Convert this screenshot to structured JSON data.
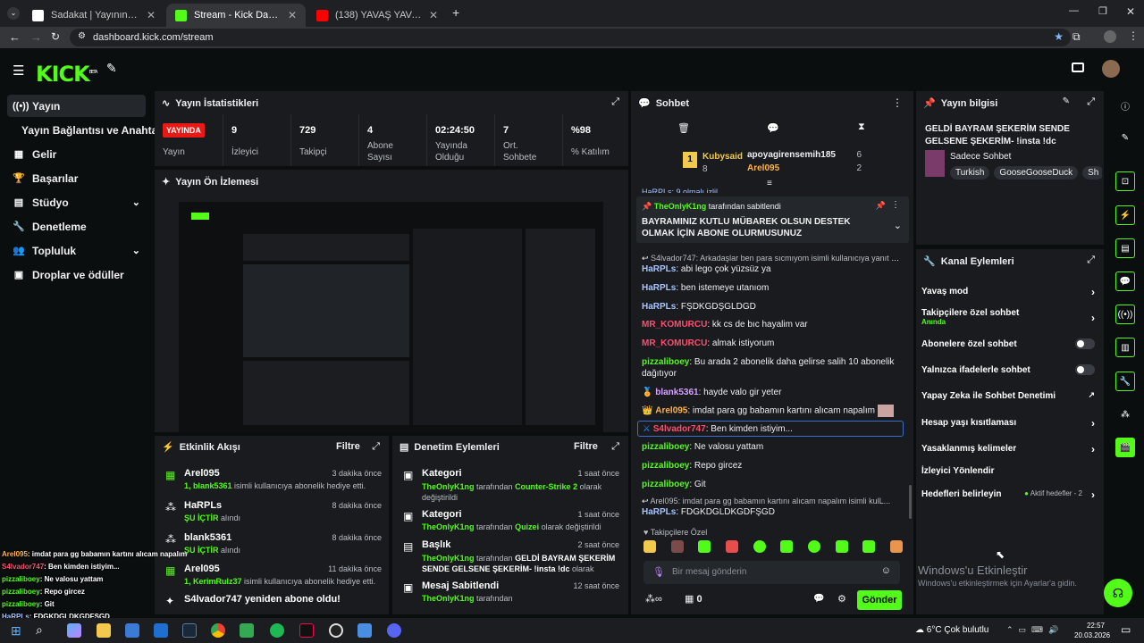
{
  "browser": {
    "tabs": [
      {
        "title": "Sadakat | Yayınını güçlendirmek"
      },
      {
        "title": "Stream - Kick Dashboard"
      },
      {
        "title": "(138) YAVAŞ YAVAŞ GELİŞİYORU"
      }
    ],
    "url": "dashboard.kick.com/stream"
  },
  "brand": {
    "logo": "KICK",
    "beta": "BETA",
    "accent": "#53fc18"
  },
  "sidebar": {
    "items": [
      {
        "label": "Yayın",
        "icon": "broadcast-icon"
      },
      {
        "label": "Yayın Bağlantısı ve Anahtarı"
      },
      {
        "label": "Gelir",
        "icon": "revenue-icon"
      },
      {
        "label": "Başarılar",
        "icon": "trophy-icon"
      },
      {
        "label": "Stüdyo",
        "icon": "studio-icon"
      },
      {
        "label": "Denetleme",
        "icon": "wrench-icon"
      },
      {
        "label": "Topluluk",
        "icon": "community-icon"
      },
      {
        "label": "Droplar ve ödüller",
        "icon": "drops-icon"
      }
    ]
  },
  "stats": {
    "title": "Yayın İstatistikleri",
    "live_badge": "YAYINDA",
    "live_label": "Yayın",
    "items": [
      {
        "value": "9",
        "label": "İzleyici"
      },
      {
        "value": "729",
        "label": "Takipçi"
      },
      {
        "value": "4",
        "label": "Abone Sayısı"
      },
      {
        "value": "02:24:50",
        "label": "Yayında Olduğu"
      },
      {
        "value": "7",
        "label": "Ort. Sohbete"
      },
      {
        "value": "%98",
        "label": "% Katılım"
      }
    ]
  },
  "preview": {
    "title": "Yayın Ön İzlemesi"
  },
  "activity": {
    "title": "Etkinlik Akışı",
    "filter": "Filtre",
    "items": [
      {
        "name": "Arel095",
        "time": "3 dakika önce",
        "sub_user": "1, blank5361",
        "sub_text": " isimli kullanıcıya abonelik hediye etti."
      },
      {
        "name": "HaRPLs",
        "time": "8 dakika önce",
        "sub_user": "ŞU İÇTİR",
        "sub_text": " alındı"
      },
      {
        "name": "blank5361",
        "time": "8 dakika önce",
        "sub_user": "ŞU İÇTİR",
        "sub_text": " alındı"
      },
      {
        "name": "Arel095",
        "time": "11 dakika önce",
        "sub_user": "1, KerimRulz37",
        "sub_text": " isimli kullanıcıya abonelik hediye etti."
      },
      {
        "name": "S4lvador747 yeniden abone oldu!",
        "time": "",
        "sub_user": "",
        "sub_text": ""
      }
    ]
  },
  "moderation": {
    "title": "Denetim Eylemleri",
    "filter": "Filtre",
    "items": [
      {
        "name": "Kategori",
        "time": "1 saat önce",
        "actor": "TheOnlyK1ng",
        "mid": " tarafından ",
        "target": "Counter-Strike 2",
        "tail": " olarak değiştirildi"
      },
      {
        "name": "Kategori",
        "time": "1 saat önce",
        "actor": "TheOnlyK1ng",
        "mid": " tarafından ",
        "target": "Quizei",
        "tail": " olarak değiştirildi"
      },
      {
        "name": "Başlık",
        "time": "2 saat önce",
        "actor": "TheOnlyK1ng",
        "mid": " tarafından ",
        "target": "GELDİ BAYRAM ŞEKERİM SENDE GELSENE ŞEKERİM- !insta !dc",
        "tail": " olarak"
      },
      {
        "name": "Mesaj Sabitlendi",
        "time": "12 saat önce",
        "actor": "TheOnlyK1ng",
        "mid": " tarafından",
        "target": "",
        "tail": ""
      }
    ]
  },
  "chat": {
    "title": "Sohbet",
    "leader": {
      "name": "Kubysaid",
      "count": "8"
    },
    "top2": {
      "name": "apoyagirensemih185",
      "count": "6"
    },
    "top3": {
      "name": "Arel095",
      "count": "2"
    },
    "clipped_line": "HaRPLs: 9 olmalı izlil",
    "pinned_by_user": "TheOnlyK1ng",
    "pinned_by_text": " tarafından sabitlendi",
    "pinned_text": "BAYRAMINIZ KUTLU MÜBAREK OLSUN DESTEK OLMAK İÇİN ABONE OLURMUSUNUZ",
    "messages": [
      {
        "user": "",
        "text": "S4lvador747: Arkadaşlar ben para sıcmıyom isimli kullanıcıya yanıt ver...",
        "reply": true,
        "color": "#b9bec4"
      },
      {
        "user": "HaRPLs",
        "text": ": abi lego çok yüzsüz ya",
        "color": "#a7c4ff"
      },
      {
        "user": "HaRPLs",
        "text": ": ben istemeye utanıom",
        "color": "#a7c4ff"
      },
      {
        "user": "HaRPLs",
        "text": ": FŞDKGDŞGLDGD",
        "color": "#a7c4ff"
      },
      {
        "user": "MR_KOMURCU",
        "text": ": kk cs de bıc hayalim var",
        "color": "#ff4d6d"
      },
      {
        "user": "MR_KOMURCU",
        "text": ": almak istiyorum",
        "color": "#ff4d6d"
      },
      {
        "user": "pizzaliboey",
        "text": ": Bu arada 2 abonelik daha gelirse salih 10 abonelik dağıtıyor",
        "color": "#53fc18"
      },
      {
        "user": "blank5361",
        "text": ": hayde valo gir yeter",
        "color": "#d6a2ff"
      },
      {
        "user": "Arel095",
        "text": ": imdat para gg babamın kartını alıcam napalım",
        "color": "#ffb347"
      },
      {
        "user": "S4lvador747",
        "text": ": Ben kimden istiyim...",
        "color": "#ff4d6d"
      },
      {
        "user": "pizzaliboey",
        "text": ": Ne valosu yattam",
        "color": "#53fc18"
      },
      {
        "user": "pizzaliboey",
        "text": ": Repo gircez",
        "color": "#53fc18"
      },
      {
        "user": "pizzaliboey",
        "text": ": Git",
        "color": "#53fc18"
      },
      {
        "user": "",
        "text": "Arel095: imdat para gg babamın kartını alıcam napalım isimli kulL...",
        "reply": true,
        "color": "#b9bec4"
      },
      {
        "user": "HaRPLs",
        "text": ": FDGKDGLDKGDFŞGD",
        "color": "#a7c4ff"
      }
    ],
    "followers_only": "Takipçilere Özel",
    "input_placeholder": "Bir mesaj gönderin",
    "points": "0",
    "send_label": "Gönder"
  },
  "stream_info": {
    "title": "Yayın bilgisi",
    "stream_title": "GELDİ BAYRAM ŞEKERİM SENDE GELSENE ŞEKERİM- !insta !dc",
    "category": "Sadece Sohbet",
    "tags": [
      "Turkish",
      "GooseGooseDuck",
      "Sh"
    ]
  },
  "channel_actions": {
    "title": "Kanal Eylemleri",
    "items": [
      {
        "label": "Yavaş mod",
        "kind": "arrow"
      },
      {
        "label": "Takipçilere özel sohbet",
        "sub": "Anında",
        "kind": "arrow"
      },
      {
        "label": "Abonelere özel sohbet",
        "kind": "toggle"
      },
      {
        "label": "Yalnızca ifadelerle sohbet",
        "kind": "toggle"
      },
      {
        "label": "Yapay Zeka ile Sohbet Denetimi",
        "kind": "external"
      },
      {
        "label": "Hesap yaşı kısıtlaması",
        "kind": "arrow"
      },
      {
        "label": "Yasaklanmış kelimeler",
        "kind": "arrow"
      },
      {
        "label": "İzleyici Yönlendir",
        "kind": "none"
      },
      {
        "label": "Hedefleri belirleyin",
        "kind": "arrow",
        "extra": "Aktif hedefler - 2"
      }
    ]
  },
  "windows_activation": {
    "title": "Windows'u Etkinleştir",
    "sub": "Windows'u etkinleştirmek için Ayarlar'a gidin."
  },
  "overlay_chat": [
    {
      "user": "Arel095",
      "text": ": imdat para gg babamın kartını alıcam napalım",
      "color": "#ffb347"
    },
    {
      "user": "S4lvador747",
      "text": ": Ben kimden istiyim...",
      "color": "#ff4d6d"
    },
    {
      "user": "pizzaliboey",
      "text": ": Ne valosu yattam",
      "color": "#53fc18"
    },
    {
      "user": "pizzaliboey",
      "text": ": Repo gircez",
      "color": "#53fc18"
    },
    {
      "user": "pizzaliboey",
      "text": ": Git",
      "color": "#53fc18"
    },
    {
      "user": "HaRPLs",
      "text": ": FDGKDGLDKGDFŞGD",
      "color": "#a7c4ff"
    }
  ],
  "taskbar": {
    "weather": "6°C  Çok bulutlu",
    "time": "22:57",
    "date": "20.03.2026"
  }
}
